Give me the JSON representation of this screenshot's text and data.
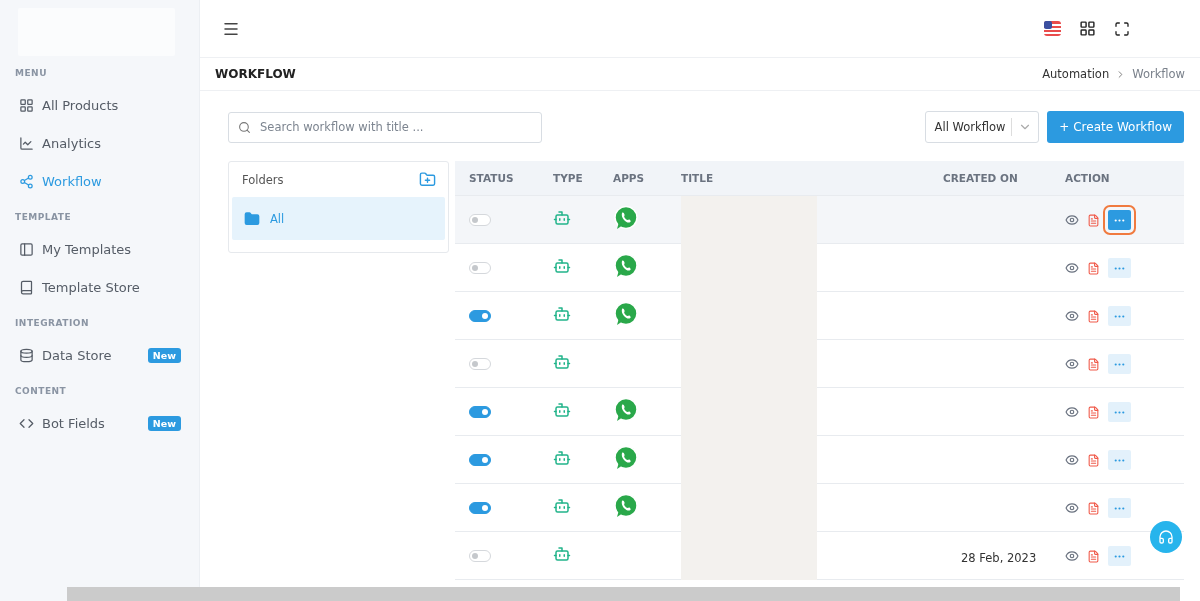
{
  "sidebar": {
    "sections": [
      {
        "title": "MENU",
        "items": [
          {
            "label": "All Products",
            "selected": false
          },
          {
            "label": "Analytics",
            "selected": false
          },
          {
            "label": "Workflow",
            "selected": true
          }
        ]
      },
      {
        "title": "TEMPLATE",
        "items": [
          {
            "label": "My Templates",
            "selected": false
          },
          {
            "label": "Template Store",
            "selected": false
          }
        ]
      },
      {
        "title": "INTEGRATION",
        "items": [
          {
            "label": "Data Store",
            "selected": false,
            "badge": "New"
          }
        ]
      },
      {
        "title": "CONTENT",
        "items": [
          {
            "label": "Bot Fields",
            "selected": false,
            "badge": "New"
          }
        ]
      }
    ]
  },
  "page": {
    "title": "WORKFLOW",
    "breadcrumb": [
      "Automation",
      "Workflow"
    ]
  },
  "search": {
    "placeholder": "Search workflow with title ..."
  },
  "filter": {
    "value": "All Workflow"
  },
  "create_button": "+ Create Workflow",
  "folders": {
    "title": "Folders",
    "items": [
      {
        "label": "All",
        "selected": true
      }
    ]
  },
  "table": {
    "columns": [
      "STATUS",
      "TYPE",
      "APPS",
      "TITLE",
      "CREATED ON",
      "ACTION"
    ],
    "rows": [
      {
        "on": false,
        "whatsapp": true,
        "selected": true
      },
      {
        "on": false,
        "whatsapp": true,
        "selected": false
      },
      {
        "on": true,
        "whatsapp": true,
        "selected": false
      },
      {
        "on": false,
        "whatsapp": false,
        "selected": false
      },
      {
        "on": true,
        "whatsapp": true,
        "selected": false
      },
      {
        "on": true,
        "whatsapp": true,
        "selected": false
      },
      {
        "on": true,
        "whatsapp": true,
        "selected": false
      },
      {
        "on": false,
        "whatsapp": false,
        "selected": false,
        "created_on": "28 Feb, 2023"
      }
    ]
  }
}
